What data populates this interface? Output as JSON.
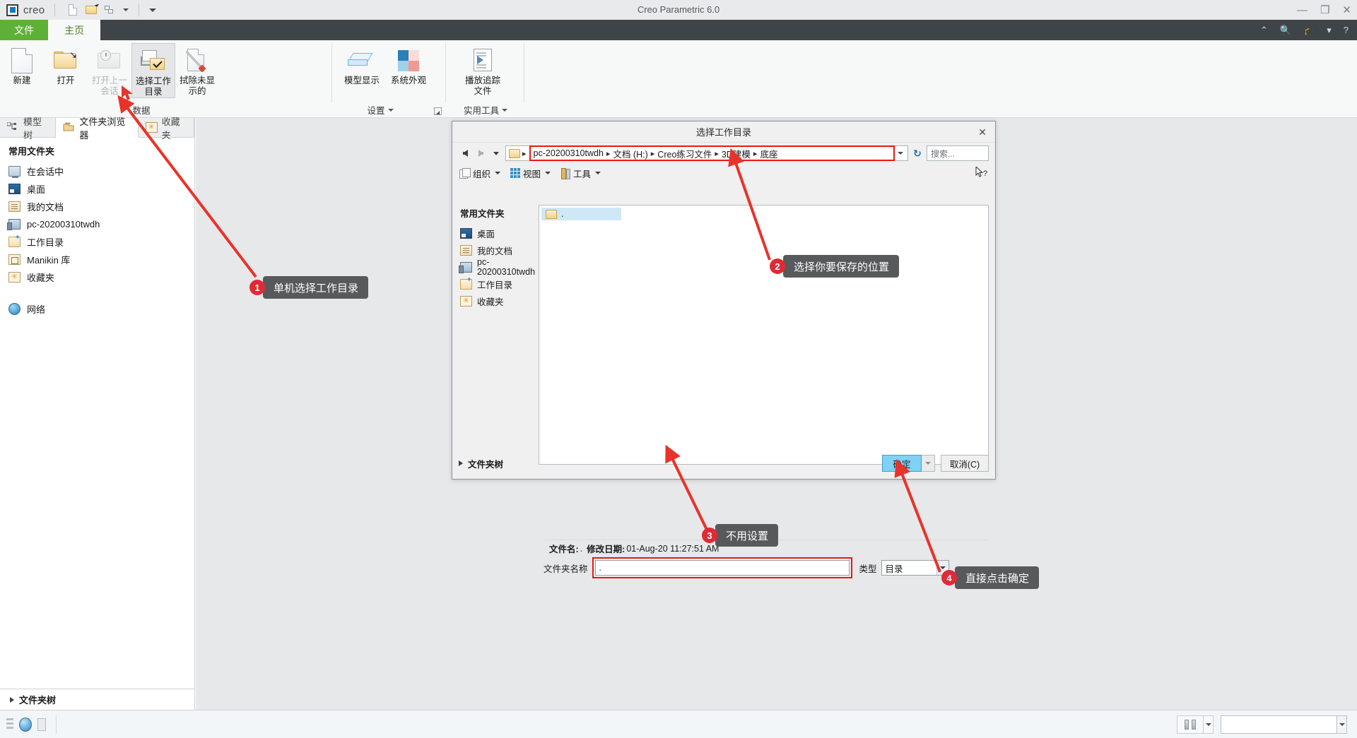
{
  "window": {
    "title": "Creo Parametric 6.0",
    "brand": "creo",
    "minimize": "—",
    "maximize": "❐",
    "close": "✕"
  },
  "quick_access": {
    "new_label": "new-document",
    "open_label": "open-document",
    "session_label": "window-list",
    "more_label": "customize-quick-access"
  },
  "tabs": [
    {
      "label": "文件",
      "name": "tab-file"
    },
    {
      "label": "主页",
      "name": "tab-home"
    }
  ],
  "tab_right_icons": [
    "chevron-up",
    "search",
    "graduation-cap",
    "chevron-down",
    "help"
  ],
  "ribbon": {
    "groups": [
      {
        "name": "data",
        "label": "数据",
        "has_caret": false,
        "has_launcher": false,
        "items": [
          {
            "label": "新建",
            "icon": "new-file-icon",
            "state": "normal"
          },
          {
            "label": "打开",
            "icon": "open-folder-icon",
            "state": "normal"
          },
          {
            "label": "打开上一\n会话",
            "icon": "open-last-session-icon",
            "state": "disabled"
          },
          {
            "label": "选择工作\n目录",
            "icon": "select-working-directory-icon",
            "state": "selected"
          },
          {
            "label": "拭除未显\n示的",
            "icon": "erase-not-displayed-icon",
            "state": "normal"
          }
        ]
      },
      {
        "name": "settings",
        "label": "设置",
        "has_caret": true,
        "has_launcher": true,
        "items": [
          {
            "label": "模型显示",
            "icon": "model-display-icon",
            "state": "normal"
          },
          {
            "label": "系统外观",
            "icon": "system-appearance-icon",
            "state": "normal"
          }
        ]
      },
      {
        "name": "utilities",
        "label": "实用工具",
        "has_caret": true,
        "has_launcher": false,
        "items": [
          {
            "label": "播放追踪\n文件",
            "icon": "play-trail-file-icon",
            "state": "normal"
          }
        ]
      }
    ]
  },
  "nav_panel": {
    "tabs": [
      {
        "label": "模型树",
        "icon": "model-tree-icon",
        "active": false
      },
      {
        "label": "文件夹浏览器",
        "icon": "folder-browser-icon",
        "active": true
      },
      {
        "label": "收藏夹",
        "icon": "favorites-icon",
        "active": false
      }
    ],
    "header": "常用文件夹",
    "items": [
      {
        "label": "在会话中",
        "icon": "in-session-icon"
      },
      {
        "label": "桌面",
        "icon": "desktop-icon"
      },
      {
        "label": "我的文档",
        "icon": "my-documents-icon"
      },
      {
        "label": "pc-20200310twdh",
        "icon": "computer-icon"
      },
      {
        "label": "工作目录",
        "icon": "working-directory-icon"
      },
      {
        "label": "Manikin 库",
        "icon": "manikin-library-icon"
      },
      {
        "label": "收藏夹",
        "icon": "favorites-folder-icon"
      }
    ],
    "network_label": "网络",
    "footer_label": "文件夹树"
  },
  "dialog": {
    "title": "选择工作目录",
    "close_label": "✕",
    "path_crumbs": [
      "pc-20200310twdh",
      "文档 (H:)",
      "Creo练习文件",
      "3D建模",
      "底座"
    ],
    "crumb_separator": "▸",
    "search_placeholder": "搜索...",
    "refresh_label": "↻",
    "toolbar": [
      {
        "label": "组织",
        "icon": "organize-icon"
      },
      {
        "label": "视图",
        "icon": "view-icon"
      },
      {
        "label": "工具",
        "icon": "tools-icon"
      }
    ],
    "help_cursor": "?",
    "side_header": "常用文件夹",
    "side_items": [
      {
        "label": "桌面",
        "icon": "desktop-icon"
      },
      {
        "label": "我的文档",
        "icon": "my-documents-icon"
      },
      {
        "label": "pc-20200310twdh",
        "icon": "computer-icon"
      },
      {
        "label": "工作目录",
        "icon": "working-directory-icon"
      },
      {
        "label": "收藏夹",
        "icon": "favorites-folder-icon"
      }
    ],
    "list_rows": [
      {
        "label": ".",
        "icon": "folder-icon",
        "selected": true
      }
    ],
    "fileinfo_name_label": "文件名:",
    "fileinfo_name_value": ".",
    "fileinfo_date_label": "修改日期:",
    "fileinfo_date_value": "01-Aug-20 11:27:51 AM",
    "foldername_label": "文件夹名称",
    "foldername_value": ".",
    "type_label": "类型",
    "type_value": "目录",
    "foldertree_label": "文件夹树",
    "ok_label": "确定",
    "cancel_label": "取消(C)"
  },
  "annotations": [
    {
      "num": "1",
      "text": "单机选择工作目录"
    },
    {
      "num": "2",
      "text": "选择你要保存的位置"
    },
    {
      "num": "3",
      "text": "不用设置"
    },
    {
      "num": "4",
      "text": "直接点击确定"
    }
  ],
  "colors": {
    "file_tab_green": "#5eb136",
    "ribbon_bg": "#f7f8f8",
    "tabstrip_dark": "#3e4447",
    "annotation_red": "#e02a36",
    "highlight_red": "#f01414",
    "ok_button_blue": "#7fd1f5",
    "selection_blue": "#cfe8f7"
  }
}
